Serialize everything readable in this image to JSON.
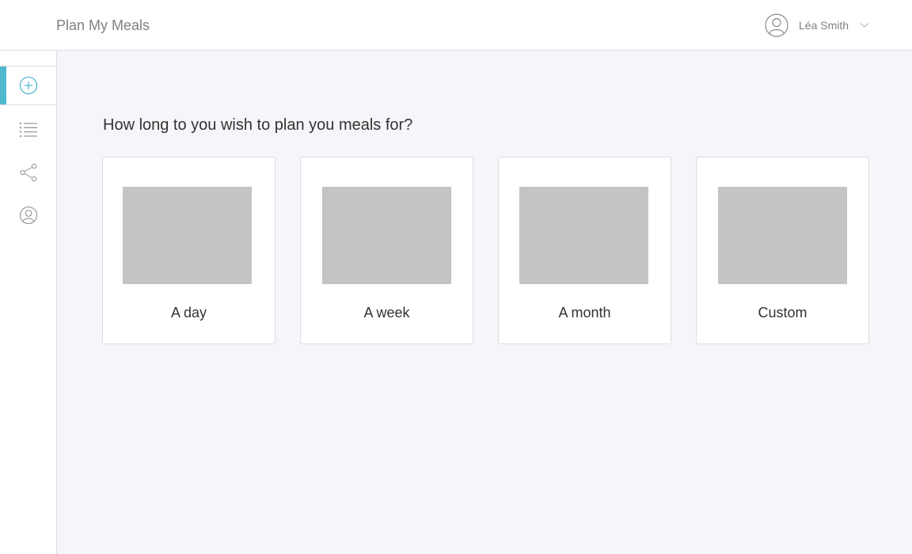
{
  "header": {
    "app_title": "Plan My Meals",
    "user": {
      "name": "Léa Smith",
      "avatar_icon": "user-circle-icon",
      "menu_icon": "chevron-down-icon"
    }
  },
  "sidebar": {
    "accent_color": "#4fb9cf",
    "items": [
      {
        "id": "new-plan",
        "icon": "plus-circle-icon",
        "active": true
      },
      {
        "id": "list",
        "icon": "list-icon",
        "active": false
      },
      {
        "id": "share",
        "icon": "share-icon",
        "active": false
      },
      {
        "id": "profile",
        "icon": "user-icon",
        "active": false
      }
    ]
  },
  "main": {
    "question": "How long to you wish to plan you meals for?",
    "options": [
      {
        "label": "A day"
      },
      {
        "label": "A week"
      },
      {
        "label": "A month"
      },
      {
        "label": "Custom"
      }
    ]
  }
}
